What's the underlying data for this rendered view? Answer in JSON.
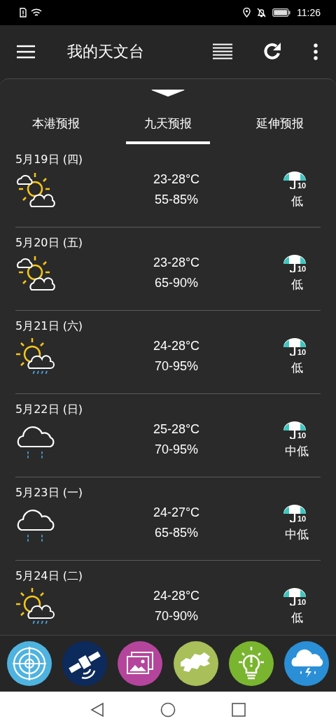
{
  "status_bar": {
    "time": "11:26"
  },
  "app_bar": {
    "title": "我的天文台"
  },
  "tabs": [
    {
      "label": "本港预报",
      "selected": false
    },
    {
      "label": "九天预报",
      "selected": true
    },
    {
      "label": "延伸预报",
      "selected": false
    }
  ],
  "forecast": [
    {
      "date": "5月19日 (四)",
      "kind": "cloudy_sun",
      "temperature": "23-28°C",
      "humidity": "55-85%",
      "rain_code": "10",
      "rain_chance": "低"
    },
    {
      "date": "5月20日 (五)",
      "kind": "cloudy_sun",
      "temperature": "23-28°C",
      "humidity": "65-90%",
      "rain_code": "10",
      "rain_chance": "低"
    },
    {
      "date": "5月21日 (六)",
      "kind": "sun_rain",
      "temperature": "24-28°C",
      "humidity": "70-95%",
      "rain_code": "10",
      "rain_chance": "低"
    },
    {
      "date": "5月22日 (日)",
      "kind": "cloud_rain",
      "temperature": "25-28°C",
      "humidity": "70-95%",
      "rain_code": "10",
      "rain_chance": "中低"
    },
    {
      "date": "5月23日 (一)",
      "kind": "cloud_rain",
      "temperature": "24-27°C",
      "humidity": "65-85%",
      "rain_code": "10",
      "rain_chance": "中低"
    },
    {
      "date": "5月24日 (二)",
      "kind": "sun_rain",
      "temperature": "24-28°C",
      "humidity": "70-90%",
      "rain_code": "10",
      "rain_chance": "低"
    }
  ],
  "shortcuts": [
    {
      "kind": "radar",
      "color": "#4fb3e0"
    },
    {
      "kind": "satellite",
      "color": "#0d2a5c"
    },
    {
      "kind": "photos",
      "color": "#b5459c"
    },
    {
      "kind": "map",
      "color": "#a8bf5a"
    },
    {
      "kind": "tips",
      "color": "#7ab530"
    },
    {
      "kind": "storm",
      "color": "#2a8fd6"
    }
  ]
}
